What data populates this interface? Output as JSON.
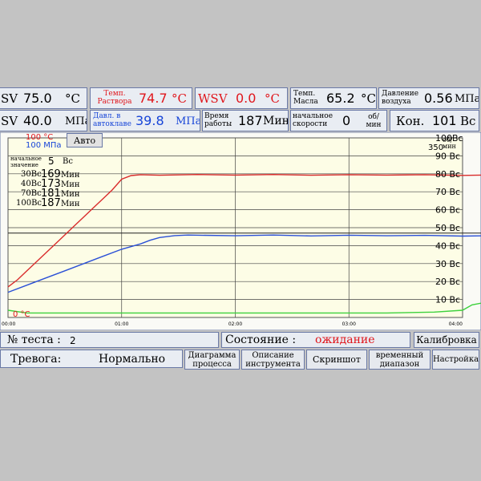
{
  "top": {
    "sv_temp": {
      "label": "SV",
      "value": "75.0",
      "unit": "°C"
    },
    "temp_solution": {
      "label": "Темп. Раствора",
      "value": "74.7",
      "unit": "°C"
    },
    "wsv": {
      "label": "WSV",
      "value": "0.0",
      "unit": "°C"
    },
    "temp_oil": {
      "label": "Темп. Масла",
      "value": "65.2",
      "unit": "°C"
    },
    "air_pressure": {
      "label": "Давление воздуха",
      "value": "0.56",
      "unit": "МПа"
    },
    "sv_pressure": {
      "label": "SV",
      "value": "40.0",
      "unit": "МПа"
    },
    "vessel_pressure": {
      "label": "Давл. в автоклаве",
      "value": "39.8",
      "unit": "МПа"
    },
    "work_time": {
      "label": "Время работы",
      "value": "187",
      "unit": "Мин"
    },
    "start_speed": {
      "label": "начальное скорости",
      "value": "0",
      "unit": "об/мин"
    },
    "con": {
      "label": "Кон.",
      "value": "101",
      "unit": "Вс"
    }
  },
  "legend": {
    "temp_top": "100 °C",
    "press_top": "100 МПа",
    "temp_bottom": "0 °C",
    "auto_button": "Авто"
  },
  "info": {
    "initial_label": "начальное значение",
    "initial_value": "5",
    "initial_unit": "Вс",
    "rows": [
      {
        "label": "30Вс",
        "value": "169",
        "unit": "Мин"
      },
      {
        "label": "40Вс",
        "value": "173",
        "unit": "Мин"
      },
      {
        "label": "70Вс",
        "value": "181",
        "unit": "Мин"
      },
      {
        "label": "100Вс",
        "value": "187",
        "unit": "Мин"
      }
    ]
  },
  "right_axis_top": {
    "value": "350",
    "unit": "об/мин"
  },
  "chart_data": {
    "type": "line",
    "x_ticks": [
      "00:00",
      "01:00",
      "02:00",
      "03:00",
      "04:00"
    ],
    "x_range_min": [
      0,
      240
    ],
    "y_right_ticks": [
      "10 Вс",
      "20 Вс",
      "30 Вс",
      "40 Вс",
      "50 Вс",
      "60 Вс",
      "70 Вс",
      "80 Вс",
      "90 Вс",
      "100Вс"
    ],
    "y_range": [
      0,
      100
    ],
    "grid": true,
    "reference_line": 47,
    "series": [
      {
        "color": "#d92c2c",
        "points": [
          [
            0,
            17
          ],
          [
            5,
            21
          ],
          [
            10,
            26
          ],
          [
            15,
            31
          ],
          [
            20,
            36
          ],
          [
            25,
            41
          ],
          [
            30,
            46
          ],
          [
            35,
            51
          ],
          [
            40,
            56
          ],
          [
            45,
            61
          ],
          [
            50,
            66
          ],
          [
            55,
            71
          ],
          [
            60,
            77
          ],
          [
            65,
            79
          ],
          [
            70,
            79.5
          ],
          [
            80,
            79.2
          ],
          [
            100,
            79.6
          ],
          [
            120,
            79.3
          ],
          [
            140,
            79.6
          ],
          [
            160,
            79.2
          ],
          [
            180,
            79.5
          ],
          [
            200,
            79.3
          ],
          [
            220,
            79.5
          ],
          [
            240,
            79.1
          ],
          [
            260,
            79.4
          ],
          [
            275,
            79.2
          ],
          [
            285,
            79.6
          ],
          [
            293,
            78.8
          ]
        ]
      },
      {
        "color": "#2b50d6",
        "points": [
          [
            0,
            14
          ],
          [
            10,
            18
          ],
          [
            20,
            22
          ],
          [
            30,
            26
          ],
          [
            40,
            30
          ],
          [
            50,
            34
          ],
          [
            60,
            38
          ],
          [
            70,
            41
          ],
          [
            75,
            43
          ],
          [
            80,
            44.5
          ],
          [
            88,
            45.6
          ],
          [
            95,
            45.9
          ],
          [
            120,
            45.5
          ],
          [
            140,
            45.9
          ],
          [
            160,
            45.4
          ],
          [
            180,
            45.8
          ],
          [
            200,
            45.5
          ],
          [
            220,
            45.7
          ],
          [
            240,
            45.3
          ],
          [
            260,
            45.6
          ],
          [
            275,
            45.3
          ],
          [
            285,
            45.7
          ],
          [
            293,
            45.5
          ]
        ]
      },
      {
        "color": "#3dd13d",
        "points": [
          [
            0,
            4
          ],
          [
            10,
            2.5
          ],
          [
            40,
            2.5
          ],
          [
            100,
            2.5
          ],
          [
            200,
            2.5
          ],
          [
            225,
            3
          ],
          [
            240,
            4
          ],
          [
            245,
            7
          ],
          [
            255,
            9
          ],
          [
            262,
            22
          ],
          [
            268,
            35
          ],
          [
            273,
            48
          ],
          [
            278,
            64
          ],
          [
            283,
            78
          ],
          [
            287,
            90
          ],
          [
            290,
            96
          ],
          [
            293,
            100
          ]
        ]
      }
    ]
  },
  "bottom": {
    "test_label": "№ теста :",
    "test_value": "2",
    "state_label": "Состояние :",
    "state_value": "ожидание",
    "calibration": "Калибровка",
    "alarm_label": "Тревога:",
    "alarm_value": "Нормально",
    "process_diagram": "Диаграмма процесса",
    "instrument_desc": "Описание инструмента",
    "screenshot": "Скриншот",
    "time_range": "временный диапазон",
    "settings": "Настройка"
  }
}
